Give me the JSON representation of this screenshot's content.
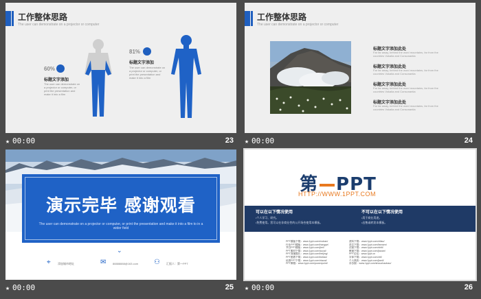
{
  "slides": [
    {
      "time": "00:00",
      "number": "23",
      "title": "工作整体思路",
      "subtitle": "The user can demonstrate on a projector or computer",
      "left_label": {
        "percent": "60%",
        "title": "标题文字添加",
        "body": "The user can demonstrate on a projector or computer, or print the presentation and make it into a film"
      },
      "right_label": {
        "percent": "81%",
        "title": "标题文字添加",
        "body": "The user can demonstrate on a projector or computer, or print the presentation and make it into a film"
      }
    },
    {
      "time": "00:00",
      "number": "24",
      "title": "工作整体思路",
      "subtitle": "The user can demonstrate on a projector or computer",
      "items": [
        {
          "title": "标题文字添加此处",
          "body": "Far far away, behind the word mountains, far from the countries Vokalia and Consonantia"
        },
        {
          "title": "标题文字添加此处",
          "body": "Far far away, behind the word mountains, far from the countries Vokalia and Consonantia"
        },
        {
          "title": "标题文字添加此处",
          "body": "Far far away, behind the word mountains, far from the countries Vokalia and Consonantia"
        },
        {
          "title": "标题文字添加此处",
          "body": "Far far away, behind the word mountains, far from the countries Vokalia and Consonantia"
        }
      ]
    },
    {
      "time": "00:00",
      "number": "25",
      "headline": "演示完毕 感谢观看",
      "body": "The user can demonstrate on a projector or computer, or print the presentation and make it into a film to in a wider field",
      "footer": [
        "添加城市地址",
        "88888888@163.com",
        "汇报人：第一PPT"
      ]
    },
    {
      "time": "00:00",
      "number": "26",
      "logo": "第一PPT",
      "logo_left": "第",
      "logo_right": "PPT",
      "url": "HTTP://WWW.1PPT.COM",
      "banner": {
        "left_title": "可以在以下情况使用",
        "left_lines": [
          "•个人学习、研究。",
          "•免费使用。您可以在非商业性的公开场合使用本模板。"
        ],
        "right_title": "不可以在以下情况使用",
        "right_lines": [
          "•用于商业用途。",
          "•出售或转发本模板。"
        ]
      },
      "links_left": [
        "PPT模板下载：www.1ppt.com/moban/",
        "行业PPT模板：www.1ppt.com/hangye/",
        "节日PPT模板：www.1ppt.com/jieri/",
        "PPT素材下载：www.1ppt.com/sucai/",
        "PPT背景图片：www.1ppt.com/beijing/",
        "PPT图表下载：www.1ppt.com/tubiao/",
        "优秀PPT下载：www.1ppt.com/xiazai/",
        "PPT教程：www.1ppt.com/powerpoint/"
      ],
      "links_right": [
        "资料下载：www.1ppt.com/ziliao/",
        "范文下载：www.1ppt.com/fanwen/",
        "试卷下载：www.1ppt.com/shiti/",
        "教案下载：www.1ppt.com/jiaoan/",
        "PPT论坛：www.1ppt.cn",
        "字体下载：www.1ppt.com/ziti/",
        "个人简历：www.1ppt.com/jianli/",
        "手抄报：www.1ppt.com/shouchaobao/"
      ]
    }
  ]
}
